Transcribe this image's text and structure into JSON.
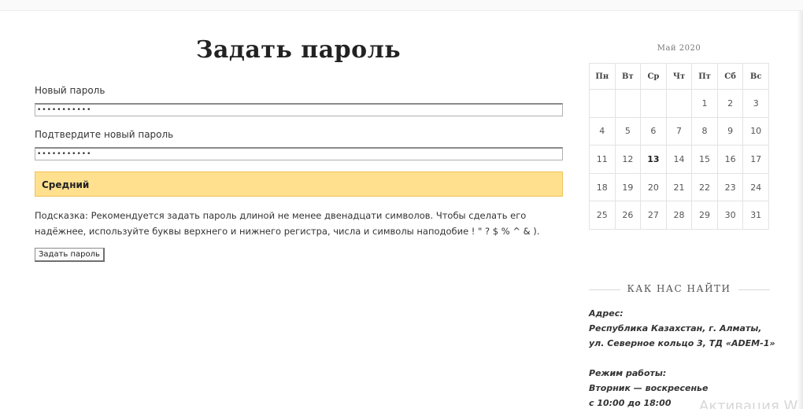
{
  "form": {
    "title": "Задать пароль",
    "new_password_label": "Новый пароль",
    "new_password_value": "•••••••••••",
    "confirm_password_label": "Подтвердите новый пароль",
    "confirm_password_value": "•••••••••••",
    "strength_label": "Средний",
    "hint_line1": "Подсказка: Рекомендуется задать пароль длиной не менее двенадцати символов. Чтобы сделать его",
    "hint_line2": "надёжнее, используйте буквы верхнего и нижнего регистра, числа и символы наподобие ! \" ? $ % ^ & ).",
    "submit_label": "Задать пароль",
    "strength_color": "#ffe08e"
  },
  "calendar": {
    "caption": "Май 2020",
    "weekdays": [
      "Пн",
      "Вт",
      "Ср",
      "Чт",
      "Пт",
      "Сб",
      "Вс"
    ],
    "weeks": [
      [
        "",
        "",
        "",
        "",
        "1",
        "2",
        "3"
      ],
      [
        "4",
        "5",
        "6",
        "7",
        "8",
        "9",
        "10"
      ],
      [
        "11",
        "12",
        "13",
        "14",
        "15",
        "16",
        "17"
      ],
      [
        "18",
        "19",
        "20",
        "21",
        "22",
        "23",
        "24"
      ],
      [
        "25",
        "26",
        "27",
        "28",
        "29",
        "30",
        "31"
      ]
    ],
    "today": "13"
  },
  "sidebar": {
    "find_us_title": "КАК НАС НАЙТИ",
    "address_heading": "Адрес:",
    "address_line1": "Республика Казахстан, г. Алматы,",
    "address_line2": "ул. Северное кольцо 3, ТД «ADEM-1»",
    "hours_heading": "Режим работы:",
    "hours_line1": "Вторник — воскресенье",
    "hours_line2": "с 10:00 до 18:00"
  },
  "watermark": "Активация W"
}
